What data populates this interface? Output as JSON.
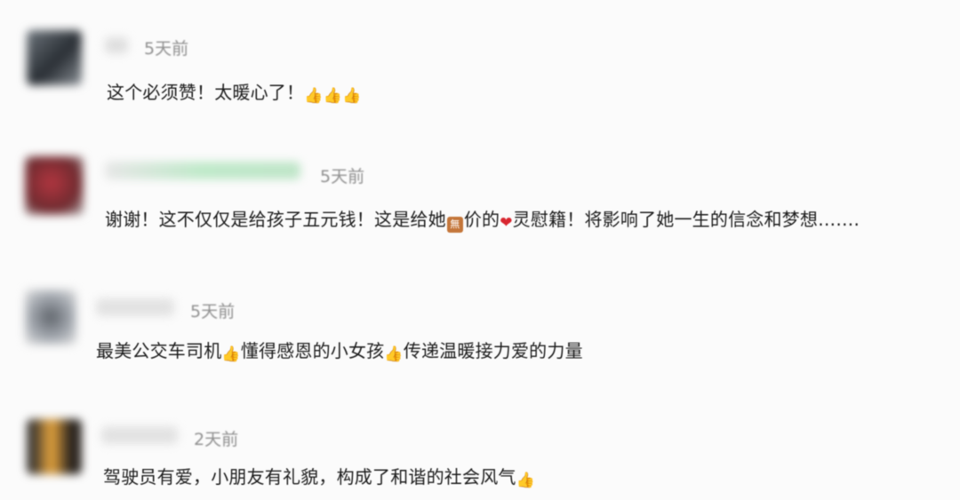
{
  "comments": [
    {
      "avatar_color": "#3b4148",
      "name_color": "#d6d6d6",
      "time": "5天前",
      "parts": [
        "这个必须赞！太暖心了！"
      ],
      "emojis": [
        "thumbs-up-icon",
        "thumbs-up-icon",
        "thumbs-up-icon"
      ]
    },
    {
      "avatar_color": "#8f2d33",
      "name_color": "#a8e0b8",
      "time": "5天前",
      "part1": "谢谢！这不仅仅是给孩子五元钱！这是给她",
      "box_glyph": "無",
      "part2": "价的",
      "part3": "灵慰籍！将影响了她一生的信念和梦想……."
    },
    {
      "avatar_color": "#9aa0a8",
      "name_color": "#dcdcdc",
      "time": "5天前",
      "part1": "最美公交车司机",
      "part2": "懂得感恩的小女孩",
      "part3": "传递温暖接力爱的力量"
    },
    {
      "avatar_color": "#e3a13a",
      "name_color": "#dcdcdc",
      "time": "2天前",
      "part1": "驾驶员有爱，小朋友有礼貌，构成了和谐的社会风气"
    }
  ]
}
